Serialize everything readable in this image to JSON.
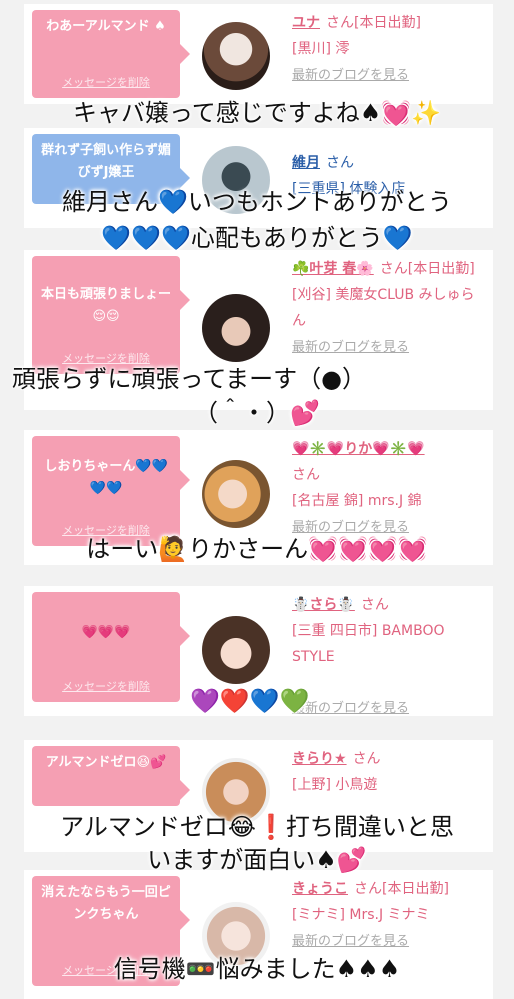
{
  "cards": [
    {
      "bubble_text": "わあーアルマンド ♠",
      "bubble_color": "#f59fb3",
      "delete_label": "メッセージを削除",
      "name": "ユナ",
      "honorific": "さん[本日出勤]",
      "shop": "[黒川] 澪",
      "blog": "最新のブログを見る"
    },
    {
      "bubble_text": "群れず子飼い作らず媚びずJ嬢王",
      "bubble_color": "#8fb6ea",
      "delete_label": "",
      "name": "維月",
      "honorific": "さん",
      "shop": "[三重県] 体験入店",
      "blog": ""
    },
    {
      "bubble_text": "本日も頑張りましょー😌😌",
      "bubble_color": "#f59fb3",
      "delete_label": "メッセージを削除",
      "name": "☘️叶芽 春🌸",
      "honorific": "さん[本日出勤]",
      "shop": "[刈谷] 美魔女CLUB みしゅらん",
      "blog": "最新のブログを見る"
    },
    {
      "bubble_text": "しおりちゃーん💙💙💙💙",
      "bubble_color": "#f59fb3",
      "delete_label": "メッセージを削除",
      "name": "💗✳️💗りか💗✳️💗",
      "honorific": "さん",
      "shop": "[名古屋 錦] mrs.J 錦",
      "blog": "最新のブログを見る"
    },
    {
      "bubble_text": "💗💗💗",
      "bubble_color": "#f59fb3",
      "delete_label": "メッセージを削除",
      "name": "☃️さら☃️",
      "honorific": "さん",
      "shop": "[三重 四日市] BAMBOO STYLE",
      "blog": "最新のブログを見る"
    },
    {
      "bubble_text": "アルマンドゼロ😆💕",
      "bubble_color": "#f59fb3",
      "delete_label": "",
      "name": "きらり★",
      "honorific": "さん",
      "shop": "[上野] 小鳥遊",
      "blog": ""
    },
    {
      "bubble_text": "消えたならもう一回ピンクちゃん",
      "bubble_color": "#f59fb3",
      "delete_label": "メッセージを削除",
      "name": "きょうこ",
      "honorific": "さん[本日出勤]",
      "shop": "[ミナミ] Mrs.J ミナミ",
      "blog": "最新のブログを見る"
    }
  ],
  "captions": [
    "キャバ嬢って感じですよね♠💓✨",
    "維月さん💙いつもホントありがとう",
    "💙💙💙心配もありがとう💙",
    "頑張らずに頑張ってまーす（●）",
    "（＾・）💕",
    "はーい🙋りかさーん💓💓💓💓",
    "💜❤️💙💚",
    "アルマンドゼロ😂❗打ち間違いと思",
    "いますが面白い♠💕",
    "信号機🚥悩みました♠♠♠"
  ]
}
